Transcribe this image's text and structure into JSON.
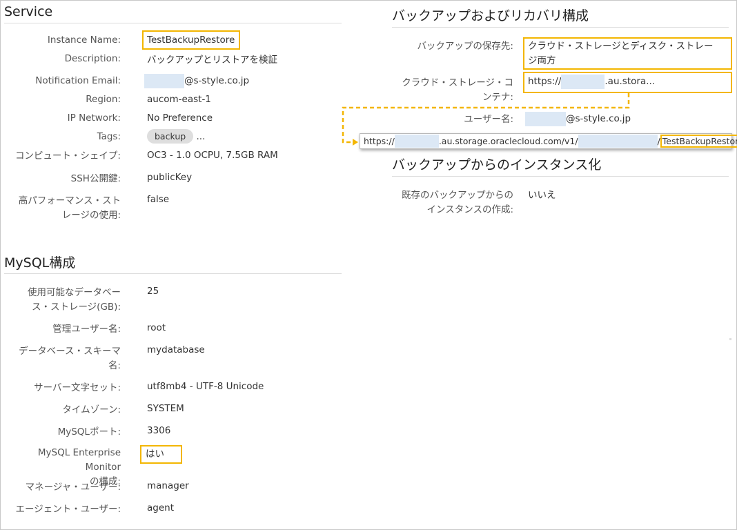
{
  "service": {
    "title": "Service",
    "fields": [
      {
        "label": "Instance Name:",
        "value": "TestBackupRestore"
      },
      {
        "label": "Description:",
        "value": "バックアップとリストアを検証"
      },
      {
        "label": "Notification Email:",
        "value": "@s-style.co.jp"
      },
      {
        "label": "Region:",
        "value": "aucom-east-1"
      },
      {
        "label": "IP Network:",
        "value": "No Preference"
      },
      {
        "label": "Tags:",
        "value": "backup",
        "more": "..."
      },
      {
        "label": "コンピュート・シェイプ:",
        "value": "OC3 - 1.0 OCPU, 7.5GB RAM"
      },
      {
        "label": "SSH公開鍵:",
        "value": "publicKey"
      },
      {
        "label_line1": "高パフォーマンス・スト",
        "label_line2": "レージの使用:",
        "value": "false"
      }
    ]
  },
  "mysql": {
    "title": "MySQL構成",
    "fields": [
      {
        "label_line1": "使用可能なデータベー",
        "label_line2": "ス・ストレージ(GB):",
        "value": "25"
      },
      {
        "label": "管理ユーザー名:",
        "value": "root"
      },
      {
        "label_line1": "データベース・スキーマ",
        "label_line2": "名:",
        "value": "mydatabase"
      },
      {
        "label": "サーバー文字セット:",
        "value": "utf8mb4 - UTF-8 Unicode"
      },
      {
        "label": "タイムゾーン:",
        "value": "SYSTEM"
      },
      {
        "label": "MySQLポート:",
        "value": "3306"
      },
      {
        "label_line1": "MySQL Enterprise Monitor",
        "label_line2": "の構成:",
        "value": "はい"
      },
      {
        "label": "マネージャ・ユーザー:",
        "value": "manager"
      },
      {
        "label": "エージェント・ユーザー:",
        "value": "agent"
      }
    ]
  },
  "backup": {
    "title": "バックアップおよびリカバリ構成",
    "fields": [
      {
        "label": "バックアップの保存先:",
        "value_line1": "クラウド・ストレージとディスク・ストレー",
        "value_line2": "ジ両方"
      },
      {
        "label_line1": "クラウド・ストレージ・コ",
        "label_line2": "ンテナ:",
        "value_prefix": "https://",
        "value_suffix": ".au.stora..."
      },
      {
        "label": "ユーザー名:",
        "value": "@s-style.co.jp"
      }
    ],
    "url_popup": {
      "prefix": "https://",
      "middle": ".au.storage.oraclecloud.com/v1/",
      "slash": "/",
      "container": "TestBackupRestore"
    }
  },
  "restore": {
    "title": "バックアップからのインスタンス化",
    "fields": [
      {
        "label_line1": "既存のバックアップからの",
        "label_line2": "インスタンスの作成:",
        "value": "いいえ"
      }
    ]
  },
  "colors": {
    "highlight": "#f3b600",
    "mask": "#dce8f5",
    "tag_bg": "#dedede"
  }
}
